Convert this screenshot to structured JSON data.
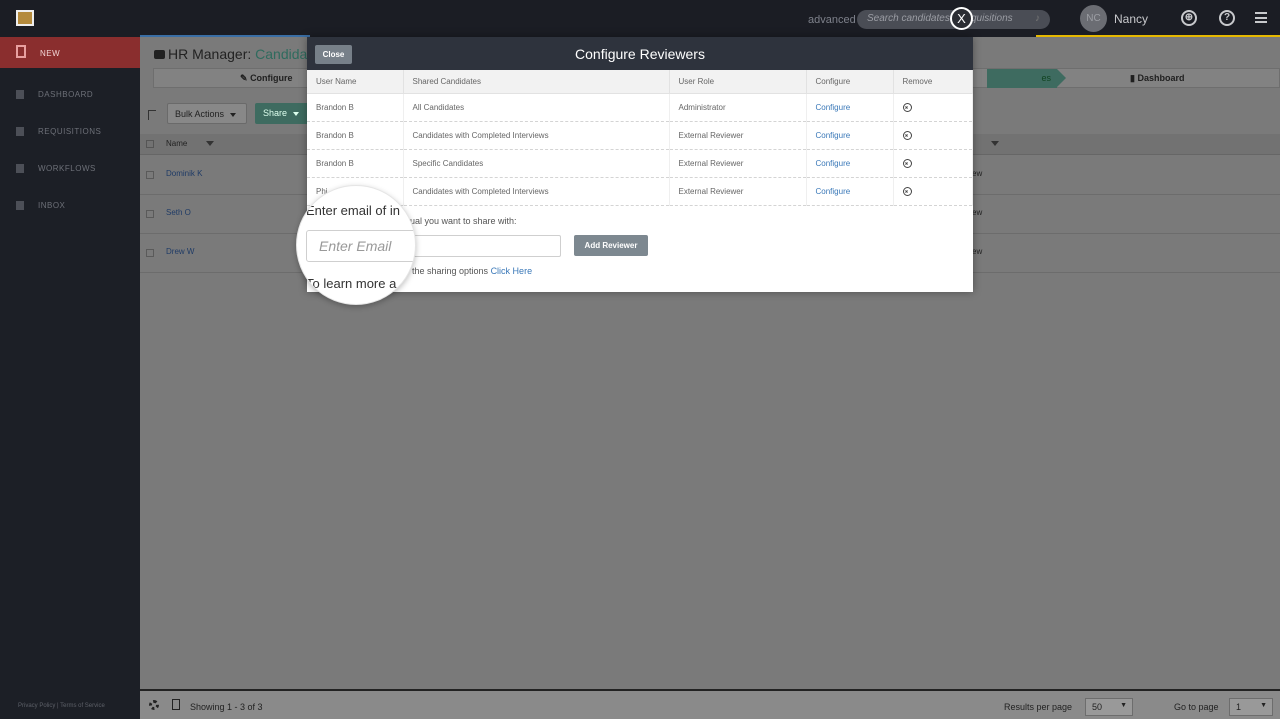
{
  "topbar": {
    "advanced_label": "advanced",
    "search_placeholder": "Search candidates & requisitions",
    "close_label": "X",
    "avatar_initials": "NC",
    "user_name": "Nancy"
  },
  "sidebar": {
    "items": [
      {
        "label": "NEW"
      },
      {
        "label": "DASHBOARD"
      },
      {
        "label": "REQUISITIONS"
      },
      {
        "label": "WORKFLOWS"
      },
      {
        "label": "INBOX"
      }
    ],
    "footer": "Privacy Policy | Terms of Service"
  },
  "main": {
    "title_prefix": "HR Manager: ",
    "title_highlight": "Candidat",
    "tabs": {
      "configure": "Configure",
      "green_tab": "es",
      "dashboard": "Dashboard"
    },
    "bulk_actions": "Bulk Actions",
    "share": "Share",
    "grid": {
      "name_header": "Name",
      "rows": [
        {
          "name": "Dominik K",
          "review": "ew"
        },
        {
          "name": "Seth O",
          "review": "ew"
        },
        {
          "name": "Drew W",
          "review": "ew"
        }
      ]
    }
  },
  "bottombar": {
    "showing": "Showing 1 - 3 of 3",
    "results_label": "Results per page",
    "results_value": "50",
    "goto_label": "Go to page",
    "goto_value": "1"
  },
  "modal": {
    "close_label": "Close",
    "title": "Configure Reviewers",
    "columns": [
      "User Name",
      "Shared Candidates",
      "User Role",
      "Configure",
      "Remove"
    ],
    "rows": [
      {
        "user": "Brandon B",
        "shared": "All Candidates",
        "role": "Administrator",
        "configure": "Configure"
      },
      {
        "user": "Brandon B",
        "shared": "Candidates with Completed Interviews",
        "role": "External Reviewer",
        "configure": "Configure"
      },
      {
        "user": "Brandon B",
        "shared": "Specific Candidates",
        "role": "External Reviewer",
        "configure": "Configure"
      },
      {
        "user": "Phi",
        "shared": "Candidates with Completed Interviews",
        "role": "External Reviewer",
        "configure": "Configure"
      }
    ],
    "share_label_tail": "ual you want to share with:",
    "email_placeholder": "Enter Email",
    "add_reviewer": "Add Reviewer",
    "learn_tail": "the sharing options ",
    "click_here": "Click Here"
  },
  "magnifier": {
    "text1": "Enter email of in",
    "placeholder": "Enter Email",
    "text2": "To learn more a"
  }
}
